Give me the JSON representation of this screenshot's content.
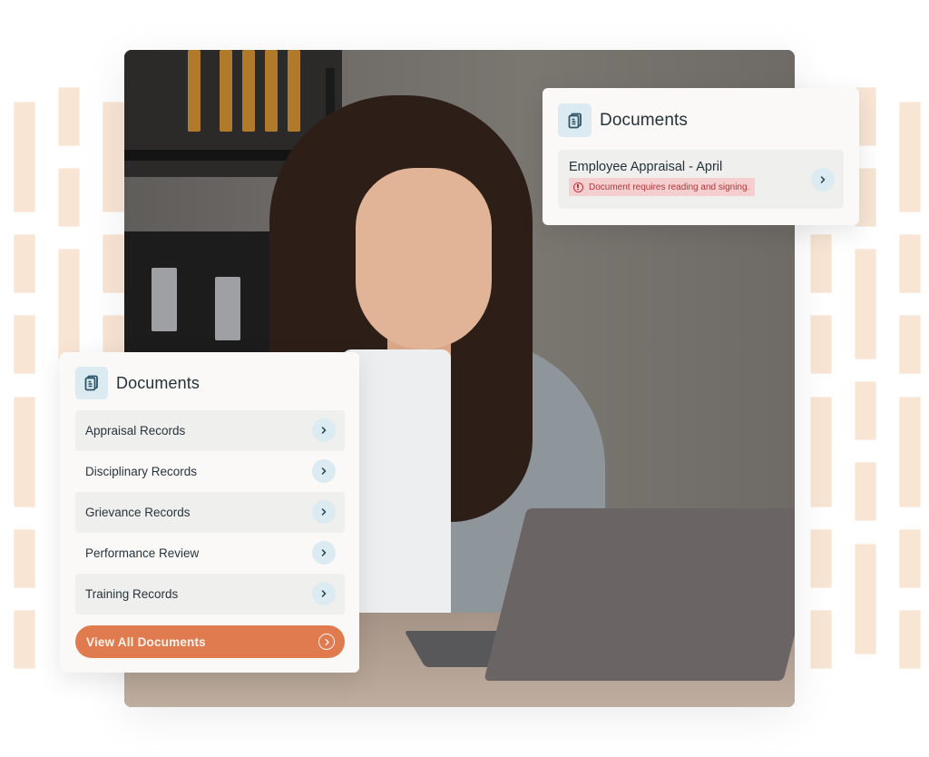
{
  "colors": {
    "accent": "#e07b4f",
    "icon_bg": "#dcebf1",
    "icon_fg": "#2e5566",
    "alert_bg": "#f5cfcf",
    "alert_fg": "#b5343a",
    "decor_bar": "#f8e5d4",
    "card_bg": "#fbf9f7"
  },
  "notification_card": {
    "title": "Documents",
    "icon": "document-stack-icon",
    "item": {
      "title": "Employee Appraisal - April",
      "alert_icon": "alert-circle-icon",
      "alert_text": "Document requires reading and signing.",
      "action_icon": "chevron-right-icon"
    }
  },
  "documents_card": {
    "title": "Documents",
    "icon": "document-stack-icon",
    "items": [
      {
        "label": "Appraisal Records",
        "icon": "chevron-right-icon"
      },
      {
        "label": "Disciplinary Records",
        "icon": "chevron-right-icon"
      },
      {
        "label": "Grievance Records",
        "icon": "chevron-right-icon"
      },
      {
        "label": "Performance Review",
        "icon": "chevron-right-icon"
      },
      {
        "label": "Training Records",
        "icon": "chevron-right-icon"
      }
    ],
    "view_all": {
      "label": "View All Documents",
      "icon": "arrow-circle-right-icon"
    }
  },
  "photo": {
    "description": "Woman in grey blazer working on laptop at office desk"
  }
}
